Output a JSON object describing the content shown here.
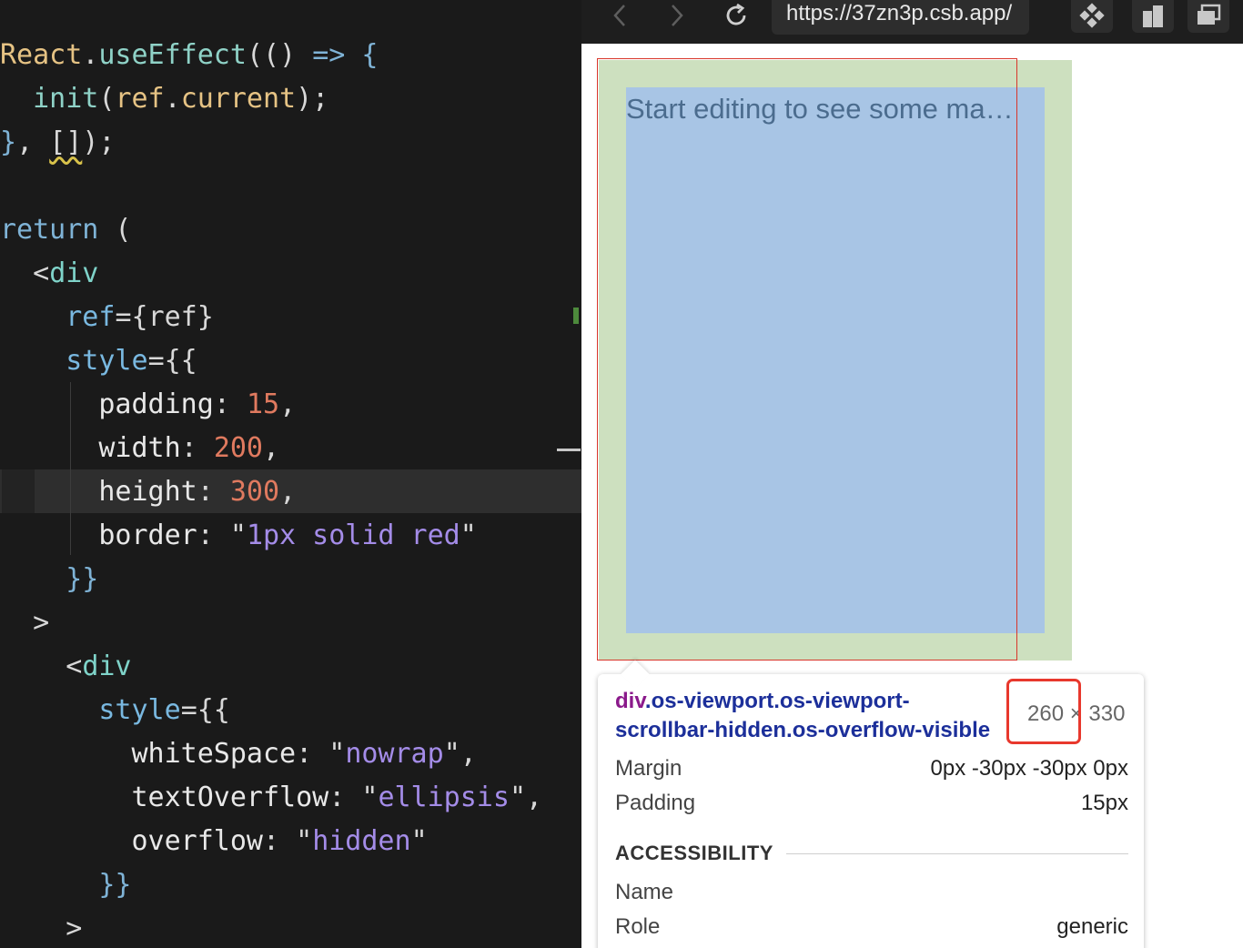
{
  "editor": {
    "lines": [
      [
        [
          "c-def",
          "React"
        ],
        [
          "c-pun",
          "."
        ],
        [
          "c-fn",
          "useEffect"
        ],
        [
          "c-pun",
          "(() "
        ],
        [
          "c-kw",
          "=>"
        ],
        [
          "c-pun",
          " "
        ],
        [
          "c-kw",
          "{"
        ]
      ],
      [
        [
          "c-pun",
          "  "
        ],
        [
          "c-fn",
          "init"
        ],
        [
          "c-pun",
          "("
        ],
        [
          "c-def",
          "ref"
        ],
        [
          "c-pun",
          "."
        ],
        [
          "c-def",
          "current"
        ],
        [
          "c-pun",
          ");"
        ]
      ],
      [
        [
          "c-kw",
          "}"
        ],
        [
          "c-pun",
          ", "
        ],
        [
          "c-pun squiggle",
          "[]"
        ],
        [
          "c-pun",
          ");"
        ]
      ],
      [],
      [
        [
          "c-kw",
          "return"
        ],
        [
          "c-pun",
          " ("
        ]
      ],
      [
        [
          "c-pun",
          "  <"
        ],
        [
          "c-tag",
          "div"
        ]
      ],
      [
        [
          "c-pun",
          "    "
        ],
        [
          "c-attr",
          "ref"
        ],
        [
          "c-pun",
          "={"
        ],
        [
          "c-pun",
          "ref"
        ],
        [
          "c-pun",
          "}"
        ]
      ],
      [
        [
          "c-pun",
          "    "
        ],
        [
          "c-attr",
          "style"
        ],
        [
          "c-pun",
          "={{"
        ]
      ],
      [
        [
          "c-pun",
          "      "
        ],
        [
          "c-prop",
          "padding"
        ],
        [
          "c-pun",
          ": "
        ],
        [
          "c-num",
          "15"
        ],
        [
          "c-pun",
          ","
        ]
      ],
      [
        [
          "c-pun",
          "      "
        ],
        [
          "c-prop",
          "width"
        ],
        [
          "c-pun",
          ": "
        ],
        [
          "c-num",
          "200"
        ],
        [
          "c-pun",
          ","
        ]
      ],
      [
        [
          "c-pun",
          "      "
        ],
        [
          "c-prop",
          "height"
        ],
        [
          "c-pun",
          ": "
        ],
        [
          "c-num",
          "300"
        ],
        [
          "c-pun",
          ","
        ]
      ],
      [
        [
          "c-pun",
          "      "
        ],
        [
          "c-prop",
          "border"
        ],
        [
          "c-pun",
          ": \""
        ],
        [
          "c-str",
          "1px solid red"
        ],
        [
          "c-pun",
          "\""
        ]
      ],
      [
        [
          "c-pun",
          "    "
        ],
        [
          "c-kw",
          "}}"
        ]
      ],
      [
        [
          "c-pun",
          "  >"
        ]
      ],
      [
        [
          "c-pun",
          "    <"
        ],
        [
          "c-tag",
          "div"
        ]
      ],
      [
        [
          "c-pun",
          "      "
        ],
        [
          "c-attr",
          "style"
        ],
        [
          "c-pun",
          "={{"
        ]
      ],
      [
        [
          "c-pun",
          "        "
        ],
        [
          "c-prop",
          "whiteSpace"
        ],
        [
          "c-pun",
          ": \""
        ],
        [
          "c-str",
          "nowrap"
        ],
        [
          "c-pun",
          "\","
        ]
      ],
      [
        [
          "c-pun",
          "        "
        ],
        [
          "c-prop",
          "textOverflow"
        ],
        [
          "c-pun",
          ": \""
        ],
        [
          "c-str",
          "ellipsis"
        ],
        [
          "c-pun",
          "\","
        ]
      ],
      [
        [
          "c-pun",
          "        "
        ],
        [
          "c-prop",
          "overflow"
        ],
        [
          "c-pun",
          ": \""
        ],
        [
          "c-str",
          "hidden"
        ],
        [
          "c-pun",
          "\""
        ]
      ],
      [
        [
          "c-pun",
          "      "
        ],
        [
          "c-kw",
          "}}"
        ]
      ],
      [
        [
          "c-pun",
          "    >"
        ]
      ]
    ]
  },
  "browser": {
    "url": "https://37zn3p.csb.app/",
    "preview_text": "Start editing to see some magic happen!",
    "colors": {
      "margin": "#cde0bf",
      "content": "#a8c5e5",
      "border": "#d9362a"
    }
  },
  "tooltip": {
    "tag": "div",
    "classes": ".os-viewport.os-viewport-scrollbar-hidden.os-overflow-visible",
    "size": "260 × 330",
    "rows": [
      {
        "label": "Margin",
        "value": "0px -30px -30px 0px"
      },
      {
        "label": "Padding",
        "value": "15px"
      }
    ],
    "section_title": "ACCESSIBILITY",
    "a11y_rows": [
      {
        "label": "Name",
        "value": ""
      },
      {
        "label": "Role",
        "value": "generic"
      }
    ]
  }
}
